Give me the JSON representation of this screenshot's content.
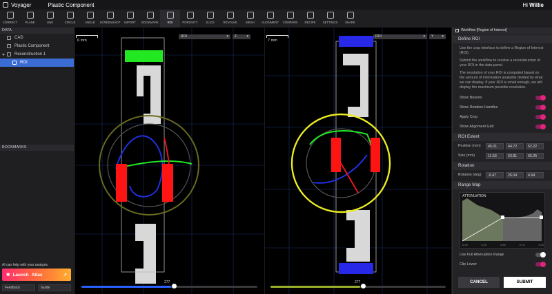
{
  "app": {
    "name": "Voyager",
    "document": "Plastic Component",
    "greeting": "Hi",
    "user": "Willie"
  },
  "toolbar": {
    "items": [
      "CORRECT",
      "PLANE",
      "LINE",
      "CIRCLE",
      "ANGLE",
      "SCREENSHOT",
      "IMPORT",
      "BOOKMARK",
      "ROI",
      "POROSITY",
      "SLICE",
      "REVOLVE",
      "MESH",
      "ALIGNMENT",
      "COMPARE",
      "RECIPE",
      "SETTINGS",
      "SHARE"
    ],
    "active": "ROI"
  },
  "left": {
    "data_label": "DATA",
    "tree": [
      {
        "label": "CAD"
      },
      {
        "label": "Plastic Component"
      },
      {
        "label": "Reconstruction 1"
      },
      {
        "label": "ROI"
      }
    ],
    "bookmarks_label": "BOOKMARKS",
    "ai_help": "AI can help with your analysis.",
    "launch_prefix": "Launch",
    "launch_name": "Atlas",
    "feedback": "Feedback",
    "guide": "Guide"
  },
  "viewport_left": {
    "scale": "6 mm",
    "mode": "ROI",
    "axis": "Z",
    "slice": "277"
  },
  "viewport_right": {
    "scale": "7 mm",
    "mode": "ROI",
    "axis": "Y",
    "slice": "277"
  },
  "right": {
    "title": "Workflow [Region of Interest]",
    "define_roi": "Define ROI",
    "p1": "Use the crop interface to define a Region of Interest (ROI).",
    "p2": "Submit the workflow to receive a reconstruction of your ROI in the data panel.",
    "p3": "The resolution of your ROI is computed based on the amount of information available divided by what we can display. If your ROI is small enough, we will display the maximum possible resolution.",
    "toggles": [
      {
        "label": "Show Bounds"
      },
      {
        "label": "Show Rotation Handles"
      },
      {
        "label": "Apply Crop"
      },
      {
        "label": "Show Alignment Grid"
      }
    ],
    "roi_extent": "ROI Extent",
    "position_label": "Position (mm)",
    "position": [
      "45.01",
      "44.72",
      "52.22"
    ],
    "size_label": "Size (mm)",
    "size": [
      "11.53",
      "63.81",
      "66.25"
    ],
    "rotation": "Rotation",
    "rotation_label": "Rotation (deg)",
    "rotation_vals": [
      "-9.47",
      "26.04",
      "4.94"
    ],
    "range_map": "Range Map",
    "attenuation": "ATTENUATION",
    "ticks": [
      "0.00",
      "0.25",
      "0.50",
      "0.75",
      "1.00"
    ],
    "full_atten": "Use Full Attenuation Range",
    "clip_lower": "Clip Lower",
    "cancel": "CANCEL",
    "submit": "SUBMIT"
  }
}
